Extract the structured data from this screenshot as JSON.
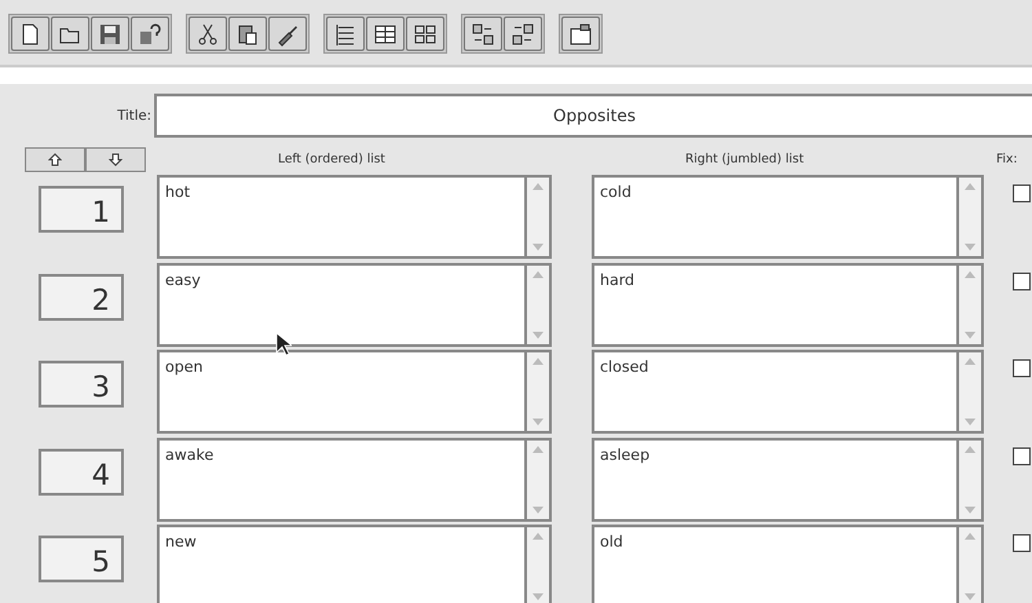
{
  "title_field": {
    "label": "Title:",
    "value": "Opposites"
  },
  "columns": {
    "left": "Left (ordered) list",
    "right": "Right (jumbled) list",
    "fix": "Fix:"
  },
  "rows": [
    {
      "number": "1",
      "left": "hot",
      "right": "cold",
      "fixed": false
    },
    {
      "number": "2",
      "left": "easy",
      "right": "hard",
      "fixed": false
    },
    {
      "number": "3",
      "left": "open",
      "right": "closed",
      "fixed": false
    },
    {
      "number": "4",
      "left": "awake",
      "right": "asleep",
      "fixed": false
    },
    {
      "number": "5",
      "left": "new",
      "right": "old",
      "fixed": false
    }
  ]
}
